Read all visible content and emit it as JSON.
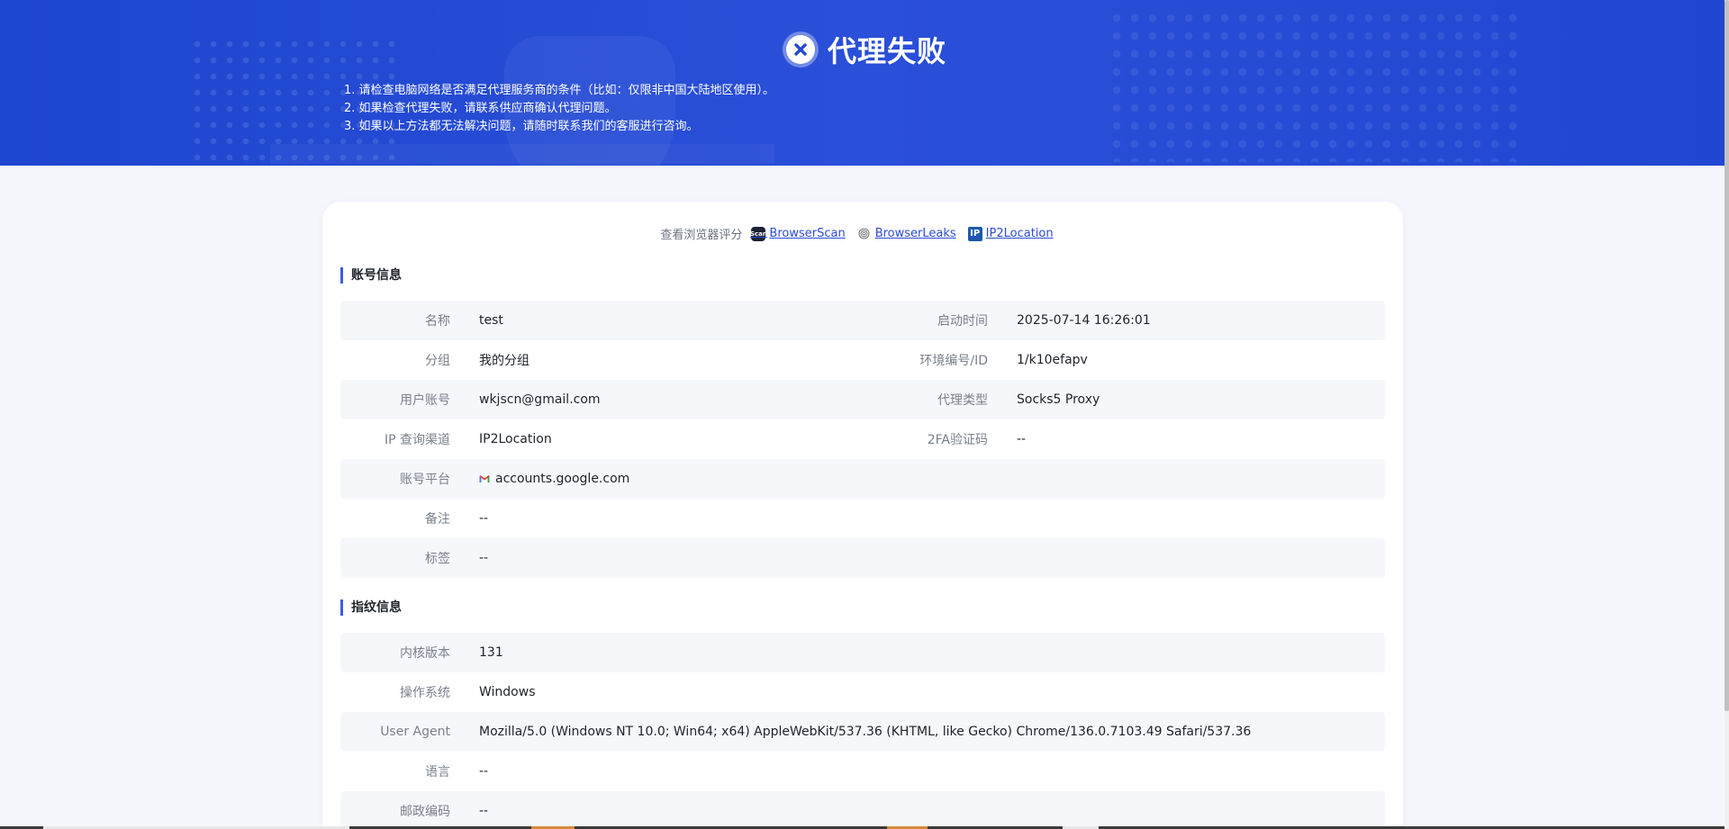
{
  "header": {
    "title": "代理失败",
    "tips": [
      "1. 请检查电脑网络是否满足代理服务商的条件（比如：仅限非中国大陆地区使用）。",
      "2. 如果检查代理失败，请联系供应商确认代理问题。",
      "3. 如果以上方法都无法解决问题，请随时联系我们的客服进行咨询。"
    ],
    "colors": {
      "banner": "#2147d2",
      "icon_fg": "#2147d2"
    }
  },
  "score": {
    "label": "查看浏览器评分",
    "links": [
      {
        "icon": "browserscan-logo",
        "logo_text": "Scan",
        "label": "BrowserScan"
      },
      {
        "icon": "fingerprint-icon",
        "label": "BrowserLeaks"
      },
      {
        "icon": "ip2location-logo",
        "logo_text": "IP",
        "label": "IP2Location"
      }
    ]
  },
  "account": {
    "title": "账号信息",
    "rows": [
      {
        "label": "名称",
        "value": "test",
        "label2": "启动时间",
        "value2": "2025-07-14 16:26:01"
      },
      {
        "label": "分组",
        "value": "我的分组",
        "label2": "环境编号/ID",
        "value2": "1/k10efapv"
      },
      {
        "label": "用户账号",
        "value": "wkjscn@gmail.com",
        "label2": "代理类型",
        "value2": "Socks5 Proxy"
      },
      {
        "label": "IP 查询渠道",
        "value": "IP2Location",
        "label2": "2FA验证码",
        "value2": "--"
      }
    ],
    "platform": {
      "label": "账号平台",
      "icon": "gmail-icon",
      "value": "accounts.google.com"
    },
    "remark": {
      "label": "备注",
      "value": "--"
    },
    "tags": {
      "label": "标签",
      "value": "--"
    }
  },
  "fingerprint": {
    "title": "指纹信息",
    "rows": [
      {
        "label": "内核版本",
        "value": "131"
      },
      {
        "label": "操作系统",
        "value": "Windows"
      },
      {
        "label": "User Agent",
        "value": "Mozilla/5.0 (Windows NT 10.0; Win64; x64) AppleWebKit/537.36 (KHTML, like Gecko) Chrome/136.0.7103.49 Safari/537.36"
      },
      {
        "label": "语言",
        "value": "--"
      },
      {
        "label": "邮政编码",
        "value": "--"
      }
    ]
  },
  "colors": {
    "accent": "#2c4bd6",
    "page_bg": "#f4f6fb",
    "row_alt": "#f6f7fb"
  }
}
